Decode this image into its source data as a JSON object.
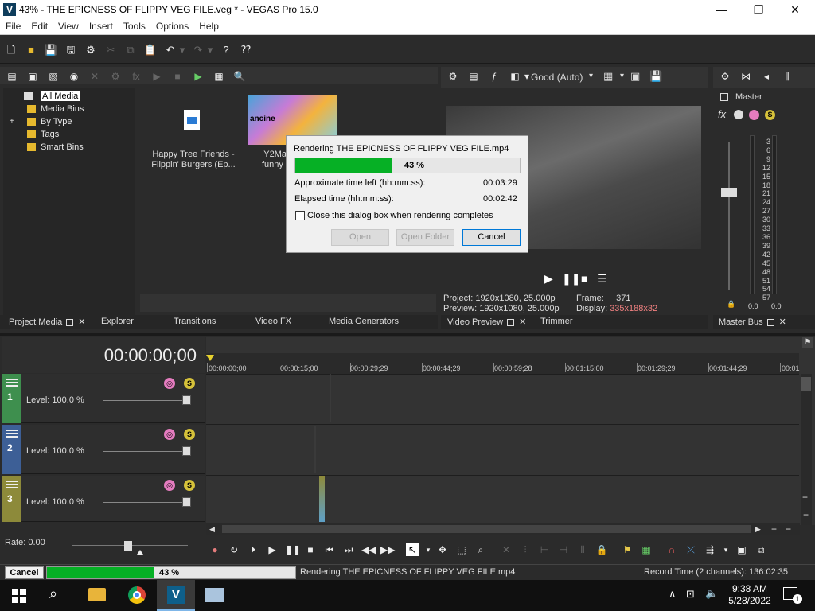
{
  "window": {
    "title": "43% - THE EPICNESS OF FLIPPY VEG FILE.veg * - VEGAS Pro 15.0",
    "logo": "V",
    "minimize": "—",
    "maximize": "❐",
    "close": "✕"
  },
  "menu": [
    "File",
    "Edit",
    "View",
    "Insert",
    "Tools",
    "Options",
    "Help"
  ],
  "project_media": {
    "tree": [
      {
        "label": "All Media",
        "selected": true
      },
      {
        "label": "Media Bins"
      },
      {
        "label": "By Type",
        "expandable": true,
        "expander": "+"
      },
      {
        "label": "Tags"
      },
      {
        "label": "Smart Bins"
      }
    ],
    "files": [
      {
        "name": "Happy Tree Friends - Flippin' Burgers (Ep...",
        "line1": "Happy Tree Friends -",
        "line2": "Flippin' Burgers (Ep..."
      },
      {
        "name": "Y2Mate.i... funny effe...",
        "line1": "Y2Mate.i",
        "line2": "funny effe",
        "thumb_text": "ancine"
      }
    ]
  },
  "preview": {
    "quality": "Good (Auto)",
    "project_label": "Project:",
    "project_val": "1920x1080, 25.000p",
    "preview_label": "Preview:",
    "preview_val": "1920x1080, 25.000p",
    "frame_label": "Frame:",
    "frame_val": "371",
    "display_label": "Display:",
    "display_val": "335x188x32",
    "display_color": "#f08080"
  },
  "master": {
    "label": "Master",
    "ticks": [
      "3",
      "6",
      "9",
      "12",
      "15",
      "18",
      "21",
      "24",
      "27",
      "30",
      "33",
      "36",
      "39",
      "42",
      "45",
      "48",
      "51",
      "54",
      "57"
    ],
    "left_val": "0.0",
    "right_val": "0.0"
  },
  "tabs": {
    "left": [
      "Project Media",
      "Explorer",
      "Transitions",
      "Video FX",
      "Media Generators"
    ],
    "mid": [
      "Video Preview",
      "Trimmer"
    ],
    "right": [
      "Master Bus"
    ]
  },
  "dialog": {
    "title": "Rendering THE EPICNESS OF FLIPPY VEG FILE.mp4",
    "progress_text": "43 %",
    "progress": 0.43,
    "time_left_label": "Approximate time left (hh:mm:ss):",
    "time_left_val": "00:03:29",
    "elapsed_label": "Elapsed time (hh:mm:ss):",
    "elapsed_val": "00:02:42",
    "checkbox_label": "Close this dialog box when rendering completes",
    "open_btn": "Open",
    "open_folder_btn": "Open Folder",
    "cancel_btn": "Cancel"
  },
  "timeline": {
    "timecode": "00:00:00;00",
    "ruler": [
      "00:00:00;00",
      "00:00:15;00",
      "00:00:29;29",
      "00:00:44;29",
      "00:00:59;28",
      "00:01:15;00",
      "00:01:29;29",
      "00:01:44;29",
      "00:01"
    ],
    "tracks": [
      {
        "num": "1",
        "level": "Level: 100.0 %",
        "color": "#3e8f4e"
      },
      {
        "num": "2",
        "level": "Level: 100.0 %",
        "color": "#3d5f96"
      },
      {
        "num": "3",
        "level": "Level: 100.0 %",
        "color": "#8d8a3a"
      }
    ],
    "rate": "Rate: 0.00"
  },
  "status": {
    "cancel": "Cancel",
    "progress_text": "43 %",
    "progress": 0.43,
    "message": "Rendering THE EPICNESS OF FLIPPY VEG FILE.mp4",
    "record_time": "Record Time (2 channels): 136:02:35"
  },
  "taskbar": {
    "time": "9:38 AM",
    "date": "5/28/2022",
    "notif_count": "1"
  }
}
